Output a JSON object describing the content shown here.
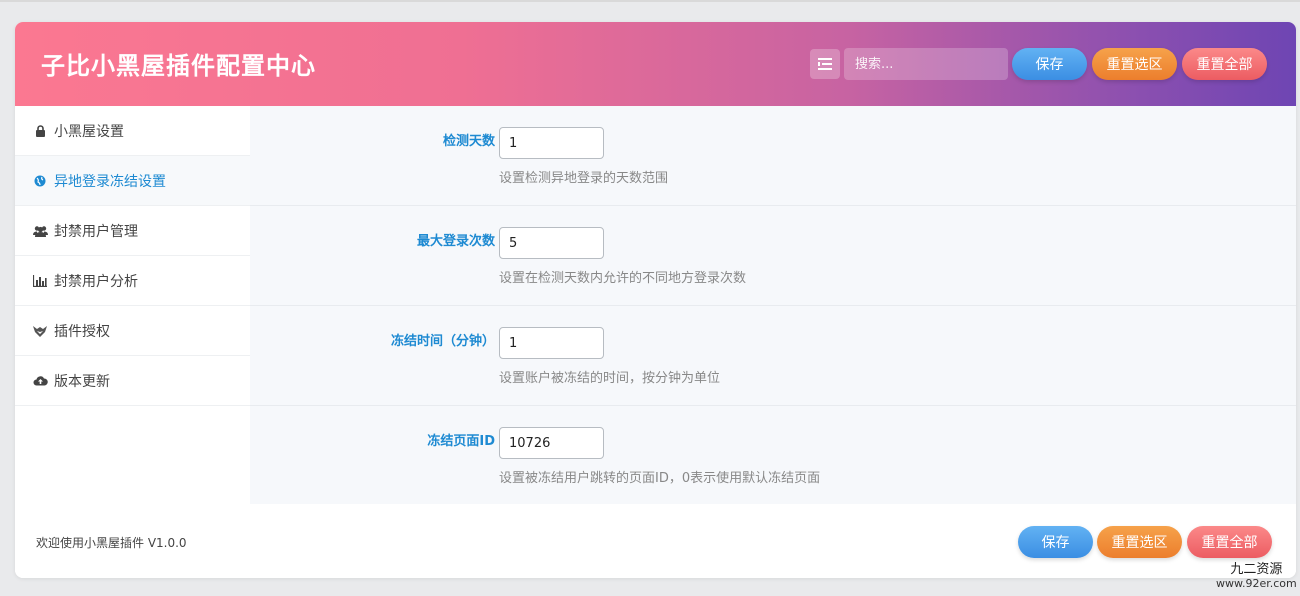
{
  "header": {
    "title": "子比小黑屋插件配置中心",
    "search_placeholder": "搜索...",
    "save_label": "保存",
    "reset_section_label": "重置选区",
    "reset_all_label": "重置全部"
  },
  "sidebar": {
    "items": [
      {
        "label": "小黑屋设置",
        "icon": "lock-icon"
      },
      {
        "label": "异地登录冻结设置",
        "icon": "globe-icon",
        "active": true
      },
      {
        "label": "封禁用户管理",
        "icon": "users-icon"
      },
      {
        "label": "封禁用户分析",
        "icon": "bar-chart-icon"
      },
      {
        "label": "插件授权",
        "icon": "fox-icon"
      },
      {
        "label": "版本更新",
        "icon": "cloud-upload-icon"
      }
    ]
  },
  "settings": {
    "rows": [
      {
        "label": "检测天数",
        "value": "1",
        "desc": "设置检测异地登录的天数范围"
      },
      {
        "label": "最大登录次数",
        "value": "5",
        "desc": "设置在检测天数内允许的不同地方登录次数"
      },
      {
        "label": "冻结时间（分钟）",
        "value": "1",
        "desc": "设置账户被冻结的时间，按分钟为单位"
      },
      {
        "label": "冻结页面ID",
        "value": "10726",
        "desc": "设置被冻结用户跳转的页面ID，0表示使用默认冻结页面"
      }
    ]
  },
  "footer": {
    "version_text": "欢迎使用小黑屋插件 V1.0.0",
    "save_label": "保存",
    "reset_section_label": "重置选区",
    "reset_all_label": "重置全部"
  },
  "watermark": {
    "line1": "九二资源",
    "line2": "www.92er.com"
  },
  "colors": {
    "accent_blue": "#1e8ad2",
    "header_gradient_start": "#fb7891",
    "header_gradient_end": "#6e45b3",
    "button_blue": "#3b8ee3",
    "button_orange": "#ec7e2d",
    "button_red": "#ec5c62"
  }
}
